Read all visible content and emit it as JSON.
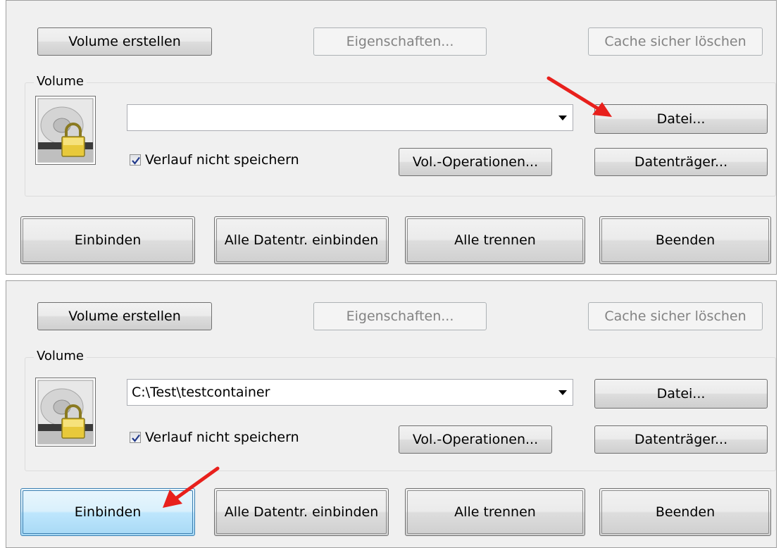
{
  "panels": [
    {
      "buttons": {
        "create_volume": "Volume erstellen",
        "properties": "Eigenschaften...",
        "wipe_cache": "Cache sicher löschen",
        "file": "Datei...",
        "vol_operations": "Vol.-Operationen...",
        "devices": "Datenträger...",
        "mount": "Einbinden",
        "auto_mount": "Alle Datentr. einbinden",
        "dismount_all": "Alle trennen",
        "exit": "Beenden"
      },
      "group_label": "Volume",
      "volume_path": "",
      "never_save_history_label": "Verlauf nicht speichern",
      "never_save_history_checked": true,
      "arrow_target": "file-button"
    },
    {
      "buttons": {
        "create_volume": "Volume erstellen",
        "properties": "Eigenschaften...",
        "wipe_cache": "Cache sicher löschen",
        "file": "Datei...",
        "vol_operations": "Vol.-Operationen...",
        "devices": "Datenträger...",
        "mount": "Einbinden",
        "auto_mount": "Alle Datentr. einbinden",
        "dismount_all": "Alle trennen",
        "exit": "Beenden"
      },
      "group_label": "Volume",
      "volume_path": "C:\\Test\\testcontainer",
      "never_save_history_label": "Verlauf nicht speichern",
      "never_save_history_checked": true,
      "arrow_target": "mount-button"
    }
  ],
  "colors": {
    "arrow": "#e8201c",
    "panel_bg": "#f0f0f0",
    "focus_border": "#3c7fb1"
  },
  "icons": [
    "drive-lock-icon",
    "checkbox-checked-icon",
    "dropdown-arrow-icon",
    "red-arrow-annotation"
  ]
}
